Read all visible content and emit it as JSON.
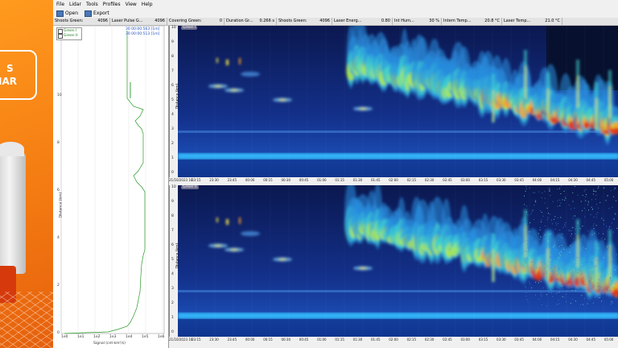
{
  "menu": [
    "File",
    "Lidar",
    "Tools",
    "Profiles",
    "View",
    "Help"
  ],
  "toolbar": {
    "open_label": "Open",
    "export_label": "Export"
  },
  "status": [
    {
      "label": "Shoots Green:",
      "value": "4096"
    },
    {
      "label": "Laser Pulse G...",
      "value": "4096"
    },
    {
      "label": "Covering Green:",
      "value": "0"
    },
    {
      "label": "Duration Gr...",
      "value": "0.266 s"
    },
    {
      "label": "Shoots Green:",
      "value": "4096"
    },
    {
      "label": "Laser Energ...",
      "value": "0.80"
    },
    {
      "label": "Int Hum...",
      "value": "30 %"
    },
    {
      "label": "Intern Temp...",
      "value": "20.8 °C"
    },
    {
      "label": "Laser Temp...",
      "value": "21.0 °C"
    }
  ],
  "profile": {
    "legend": [
      "Green I",
      "Green II"
    ],
    "timestamps": [
      "30 00:00:563 [1m]",
      "30 00:00:513 [1m]"
    ],
    "y_ticks": [
      "10",
      "8",
      "6",
      "4",
      "2",
      "0"
    ],
    "y_title": "Distance (km)",
    "x_ticks": [
      "1e0",
      "1e1",
      "1e2",
      "1e3",
      "1e4",
      "1e5",
      "1e6"
    ],
    "x_title": "Signal (cnt·km²/s)"
  },
  "panels": [
    {
      "tag": "Green I",
      "y_title": "Distance (km)"
    },
    {
      "tag": "Green II",
      "y_title": "Distance (km)"
    }
  ],
  "panel_y_ticks": [
    "10",
    "9",
    "8",
    "7",
    "6",
    "5",
    "4",
    "3",
    "2",
    "1",
    "0"
  ],
  "time_start": "21/10/2023 16:",
  "time_ticks": [
    "23:15",
    "23:30",
    "23:45",
    "00:00",
    "00:15",
    "00:30",
    "00:45",
    "01:00",
    "01:15",
    "01:30",
    "01:45",
    "02:00",
    "02:15",
    "02:30",
    "02:45",
    "03:00",
    "03:15",
    "03:30",
    "03:45",
    "04:00",
    "04:15",
    "04:30",
    "04:45",
    "05:00",
    "05:15",
    "05:30",
    "05:45",
    "06:00",
    "06:15",
    "06:30",
    "06:45",
    "07:00",
    "07:15",
    "07:30",
    "07:45",
    "08:00"
  ],
  "colors": {
    "banner": "#f47b12",
    "profile_line": "#2a9a2a",
    "plot_bg": "#0a1850",
    "timestamp": "#2050c0"
  }
}
